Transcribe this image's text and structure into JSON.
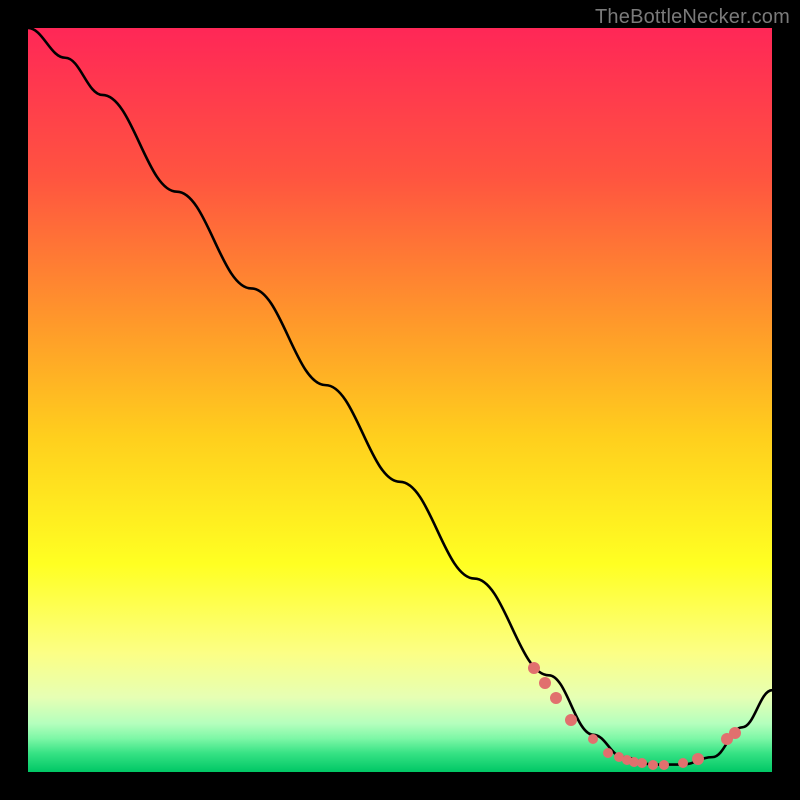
{
  "attribution": "TheBottleNecker.com",
  "chart_data": {
    "type": "line",
    "title": "",
    "xlabel": "",
    "ylabel": "",
    "xlim": [
      0,
      100
    ],
    "ylim": [
      0,
      100
    ],
    "series": [
      {
        "name": "curve",
        "x": [
          0,
          5,
          10,
          20,
          30,
          40,
          50,
          60,
          70,
          76,
          80,
          84,
          88,
          92,
          96,
          100
        ],
        "values": [
          100,
          96,
          91,
          78,
          65,
          52,
          39,
          26,
          13,
          5,
          2,
          1,
          1,
          2,
          6,
          11
        ]
      }
    ],
    "highlight_points": {
      "comment": "coral dots on the curve",
      "x": [
        68,
        69.5,
        71,
        73,
        76,
        78,
        79.5,
        80.5,
        81.5,
        82.5,
        84,
        85.5,
        88,
        90,
        94,
        95
      ],
      "y": [
        14,
        12,
        10,
        7,
        4.5,
        2.5,
        2,
        1.6,
        1.4,
        1.2,
        1.0,
        1.0,
        1.2,
        1.8,
        4.5,
        5.3
      ],
      "r": [
        6,
        6,
        6,
        6,
        5,
        5,
        5,
        5,
        5,
        5,
        5,
        5,
        5,
        6,
        6,
        6
      ]
    },
    "gradient_stops": [
      {
        "pos": 0.0,
        "color": "#ff2757"
      },
      {
        "pos": 0.2,
        "color": "#ff5440"
      },
      {
        "pos": 0.4,
        "color": "#ff9a2a"
      },
      {
        "pos": 0.55,
        "color": "#ffcf1d"
      },
      {
        "pos": 0.72,
        "color": "#ffff22"
      },
      {
        "pos": 0.84,
        "color": "#fcff85"
      },
      {
        "pos": 0.9,
        "color": "#e6ffb4"
      },
      {
        "pos": 0.935,
        "color": "#b4ffbd"
      },
      {
        "pos": 0.955,
        "color": "#7df7a6"
      },
      {
        "pos": 0.975,
        "color": "#36e284"
      },
      {
        "pos": 1.0,
        "color": "#00c765"
      }
    ]
  }
}
